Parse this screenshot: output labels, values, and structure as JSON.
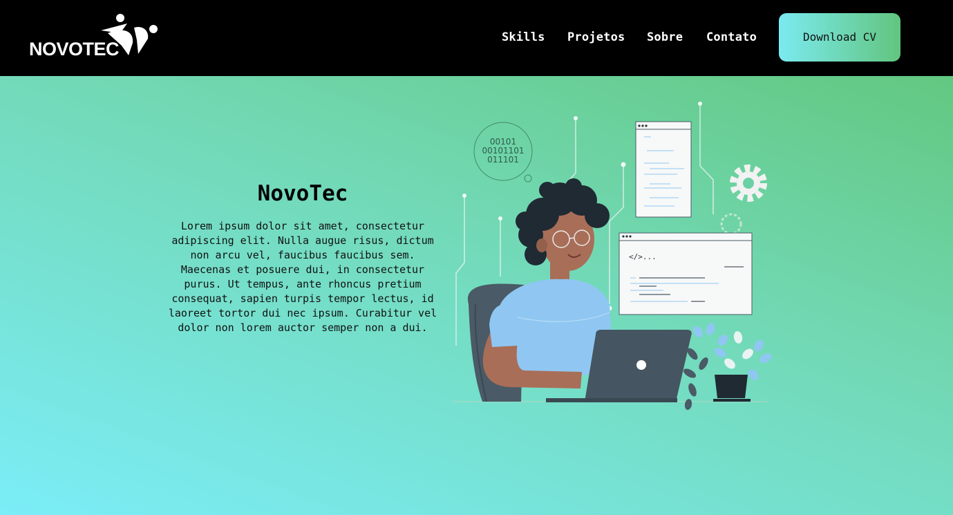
{
  "header": {
    "logo_text": "NOVOTEC",
    "nav": [
      {
        "label": "Skills"
      },
      {
        "label": "Projetos"
      },
      {
        "label": "Sobre"
      },
      {
        "label": "Contato"
      }
    ],
    "cta_label": "Download CV"
  },
  "hero": {
    "title": "NovoTec",
    "body": "Lorem ipsum dolor sit amet, consectetur adipiscing elit. Nulla augue risus, dictum non arcu vel, faucibus faucibus sem. Maecenas et posuere dui, in consectetur purus. Ut tempus, ante rhoncus pretium consequat, sapien turpis tempor lectus, id laoreet tortor dui nec ipsum. Curabitur vel dolor non lorem auctor semper non a dui."
  },
  "illustration": {
    "binary_lines": [
      "00101",
      "00101101",
      "011101"
    ],
    "code_tag": "</>..."
  },
  "colors": {
    "header_bg": "#000000",
    "gradient_cyan": "#7bedf7",
    "gradient_green": "#5ec474",
    "shirt": "#8fc7f2",
    "laptop": "#455561",
    "chair": "#4a5a66"
  },
  "icons": {
    "logo_mark": "people-celebrating-icon",
    "gear": "gear-icon",
    "plant": "plant-icon"
  }
}
